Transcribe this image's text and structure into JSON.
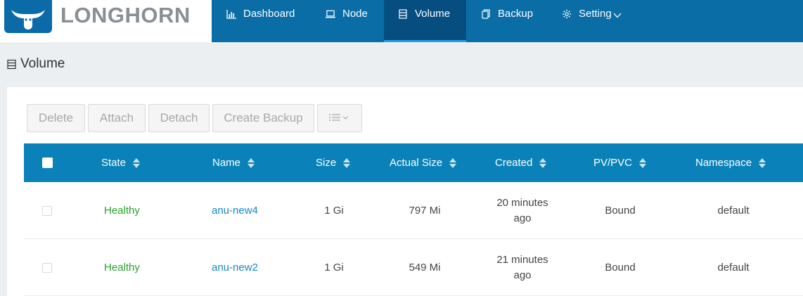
{
  "brand": {
    "name": "LONGHORN",
    "logo_icon": "longhorn-logo-icon"
  },
  "nav": [
    {
      "label": "Dashboard",
      "icon": "bar-chart-icon"
    },
    {
      "label": "Node",
      "icon": "laptop-icon"
    },
    {
      "label": "Volume",
      "icon": "database-icon",
      "active": true
    },
    {
      "label": "Backup",
      "icon": "copy-icon"
    },
    {
      "label": "Setting",
      "icon": "gear-icon",
      "has_dropdown": true
    }
  ],
  "page": {
    "title": "Volume",
    "icon": "database-icon"
  },
  "toolbar": {
    "delete": "Delete",
    "attach": "Attach",
    "detach": "Detach",
    "create_backup": "Create Backup",
    "more_icon": "list-dropdown-icon"
  },
  "table": {
    "columns": [
      "State",
      "Name",
      "Size",
      "Actual Size",
      "Created",
      "PV/PVC",
      "Namespace"
    ],
    "rows": [
      {
        "state": "Healthy",
        "name": "anu-new4",
        "size": "1 Gi",
        "actual_size": "797 Mi",
        "created_line1": "20 minutes",
        "created_line2": "ago",
        "pvpvc": "Bound",
        "namespace": "default"
      },
      {
        "state": "Healthy",
        "name": "anu-new2",
        "size": "1 Gi",
        "actual_size": "549 Mi",
        "created_line1": "21 minutes",
        "created_line2": "ago",
        "pvpvc": "Bound",
        "namespace": "default"
      }
    ]
  },
  "colors": {
    "header": "#0a6da6",
    "header_active": "#064e80",
    "table_header": "#0a82b9",
    "healthy": "#27a22c",
    "link": "#1487c9"
  }
}
